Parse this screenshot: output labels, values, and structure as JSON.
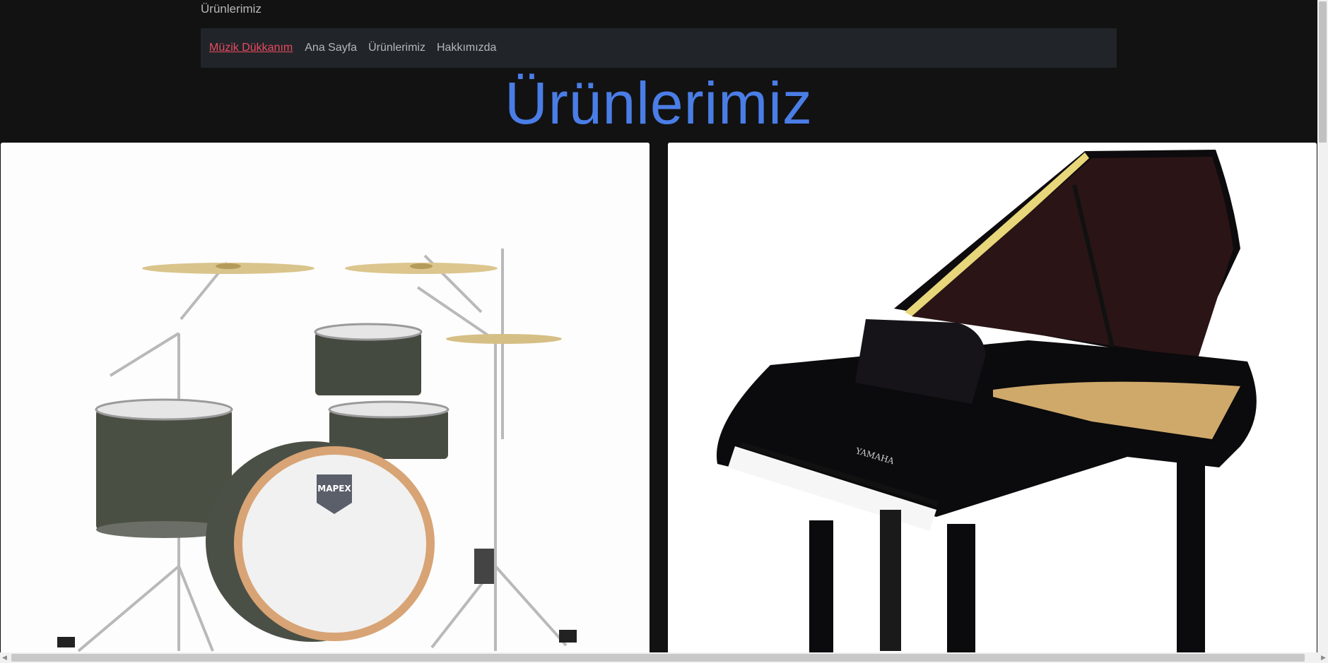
{
  "page": {
    "top_title": "Ürünlerimiz",
    "heading": "Ürünlerimiz"
  },
  "navbar": {
    "brand": "Müzik Dükkanım",
    "links": [
      "Ana Sayfa",
      "Ürünlerimiz",
      "Hakkımızda"
    ]
  },
  "products": [
    {
      "image": "drum-kit",
      "logo": "MAPEX"
    },
    {
      "image": "grand-piano",
      "logo": "YAMAHA"
    }
  ],
  "colors": {
    "background": "#121212",
    "navbar": "#212529",
    "brand": "#e84a5f",
    "heading": "#4a7de6"
  }
}
